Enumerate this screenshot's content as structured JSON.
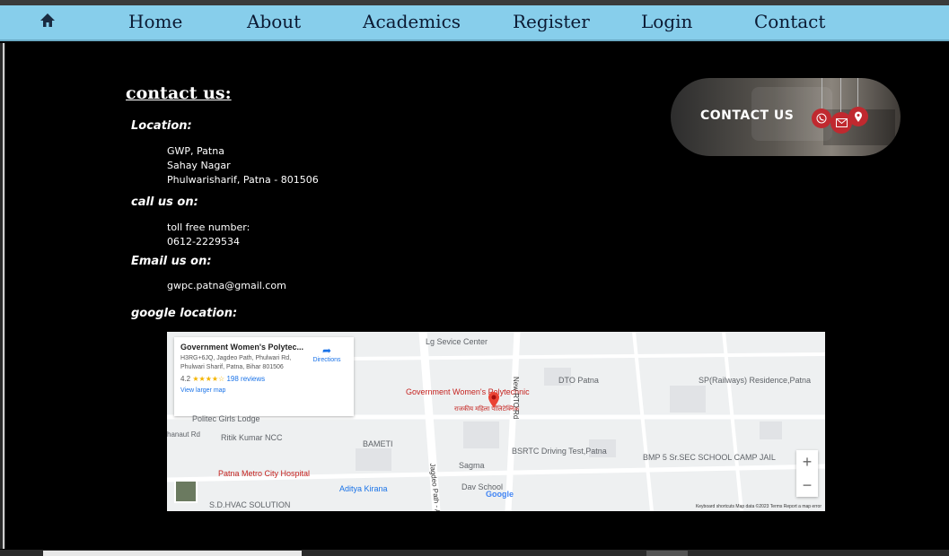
{
  "nav": {
    "home_icon": "home-icon",
    "links": [
      "Home",
      "About",
      "Academics",
      "Register",
      "Login",
      "Contact"
    ]
  },
  "section_title": "contact us:",
  "location": {
    "heading": "Location:",
    "lines": [
      "GWP, Patna",
      "Sahay Nagar",
      "Phulwarisharif, Patna - 801506"
    ]
  },
  "call": {
    "heading": "call us on:",
    "lines": [
      "toll free number:",
      "0612-2229534"
    ]
  },
  "email": {
    "heading": "Email us on:",
    "address": "gwpc.patna@gmail.com"
  },
  "google": {
    "heading": "google location:"
  },
  "contact_banner": {
    "label": "CONTACT US",
    "icons": [
      "phone-icon",
      "mail-icon",
      "location-pin-icon"
    ]
  },
  "map": {
    "card_title": "Government Women's Polytec...",
    "card_address": "H3RG+6JQ, Jagdeo Path, Phulwari Rd, Phulwari Sharif, Patna, Bihar 801506",
    "rating": "4.2",
    "reviews": "198 reviews",
    "view_larger": "View larger map",
    "directions": "Directions",
    "labels": {
      "service_center": "Lg Sevice Center",
      "gov_poly": "Government Women's Polytechnic",
      "gov_poly_hindi": "राजकीय महिला पॉलिटेक्निक",
      "dto": "DTO Patna",
      "sp": "SP(Railways) Residence,Patna",
      "politec": "Politec Girls Lodge",
      "ritik": "Ritik Kumar NCC",
      "bameti": "BAMETI",
      "bsrtc": "BSRTC Driving Test,Patna",
      "bmp": "BMP 5 Sr.SEC SCHOOL CAMP JAIL",
      "sagma": "Sagma",
      "metro": "Patna Metro City Hospital",
      "aditya": "Aditya Kirana",
      "dav": "Dav School",
      "hvac": "S.D.HVAC SOLUTION",
      "hanaut": "hanaut Rd",
      "jagdeo": "Jagdeo Path - Anisabad",
      "newrto": "New RTO Rd",
      "google_logo": "Google"
    },
    "zoom_in": "+",
    "zoom_out": "−",
    "footer": "Keyboard shortcuts    Map data ©2023    Terms    Report a map error"
  }
}
